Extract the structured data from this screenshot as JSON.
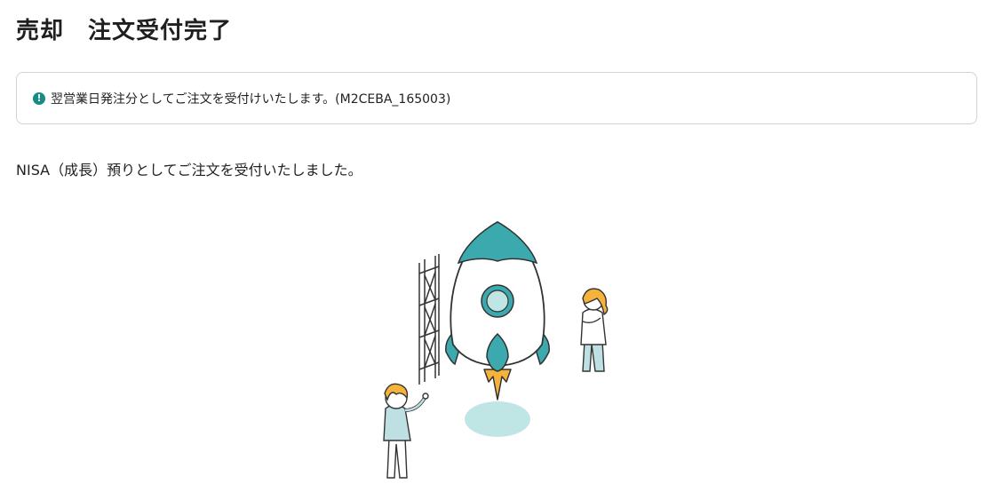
{
  "page": {
    "title": "売却　注文受付完了"
  },
  "notice": {
    "icon": "exclamation-icon",
    "text": "翌営業日発注分としてご注文を受付けいたします。(M2CEBA_165003)",
    "color": "#1a8a86"
  },
  "result": {
    "message": "NISA（成長）預りとしてご注文を受付いたしました。"
  },
  "illustration": {
    "subject": "rocket-launch-illustration",
    "accent_color": "#3ba9ad",
    "flame_color": "#f5b33b",
    "hair_color": "#f5b33b"
  }
}
